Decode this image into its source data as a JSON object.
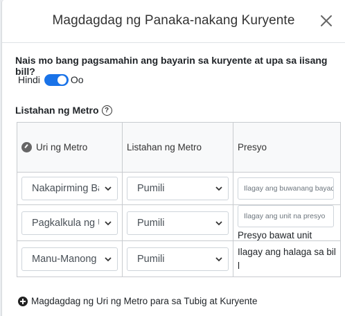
{
  "dialog": {
    "title": "Magdagdag ng Panaka-nakang Kuryente",
    "close_icon": "close-icon"
  },
  "merge_question": {
    "text": "Nais mo bang pagsamahin ang bayarin sa kuryente at upa sa iisang bill?",
    "off_label": "Hindi",
    "on_label": "Oo",
    "enabled": true
  },
  "meter_list": {
    "title": "Listahan ng Metro",
    "help_icon": "question-circle-icon",
    "headers": {
      "type": "Uri ng Metro",
      "list": "Listahan ng Metro",
      "price": "Presyo"
    },
    "rows": [
      {
        "type_value": "Nakapirming Bayad",
        "list_value": "Pumili",
        "price_placeholder": "Ilagay ang buwanang bayad"
      },
      {
        "type_value": "Pagkalkula ng Unit",
        "list_value": "Pumili",
        "price_placeholder": "Ilagay ang unit na presyo",
        "price_note": "Presyo bawat unit"
      },
      {
        "type_value": "Manu-Manong Input",
        "list_value": "Pumili",
        "price_note": "Ilagay ang halaga sa bill"
      }
    ]
  },
  "add_link": {
    "text": "Magdagdag ng Uri ng Metro para sa Tubig at Kuryente",
    "icon": "plus-circle-icon"
  },
  "colors": {
    "toggle_on": "#1a73e8",
    "border": "#c8cbcf"
  }
}
